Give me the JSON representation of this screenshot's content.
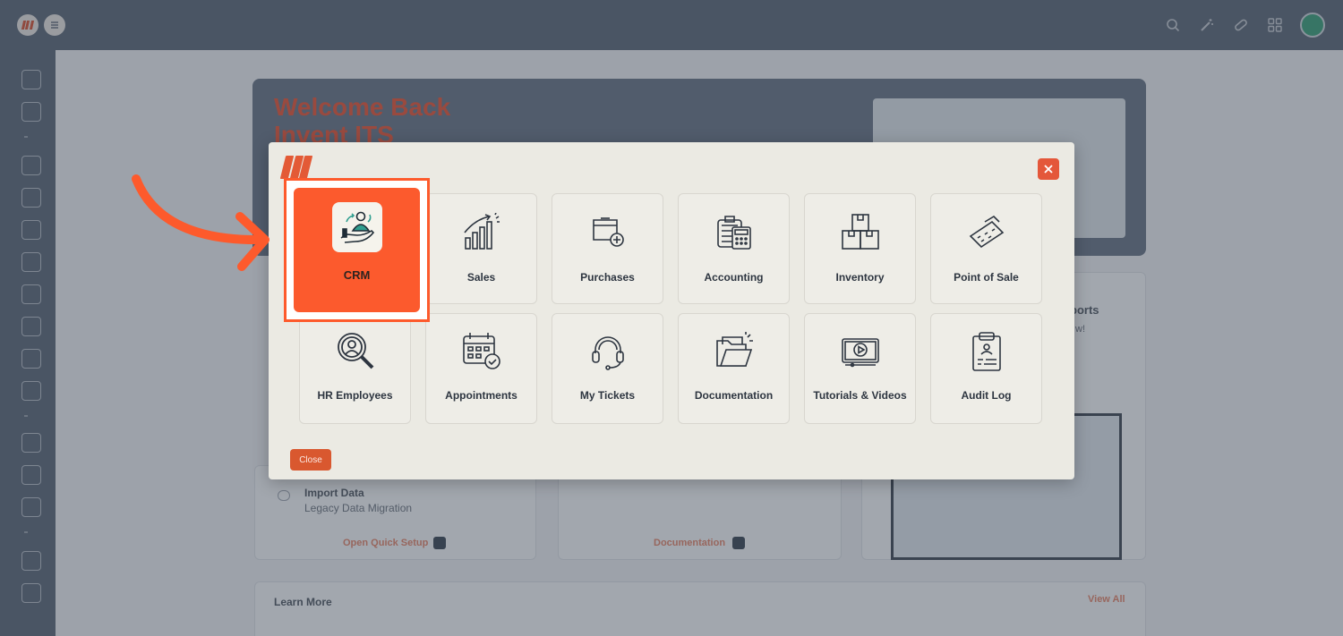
{
  "background": {
    "hero_title": "Welcome Back Invent ITS",
    "cards": {
      "import_title": "Import Data",
      "import_sub": "Legacy Data Migration",
      "open_quick_setup": "Open Quick Setup",
      "documentation": "Documentation",
      "reports_partial": "ports",
      "reports_sub_partial": "w!"
    },
    "learn_more": "Learn More",
    "view_all": "View All"
  },
  "modal": {
    "apps": [
      {
        "label": "CRM",
        "icon": "crm-icon"
      },
      {
        "label": "Sales",
        "icon": "sales-chart-icon"
      },
      {
        "label": "Purchases",
        "icon": "purchases-cart-icon"
      },
      {
        "label": "Accounting",
        "icon": "accounting-calculator-icon"
      },
      {
        "label": "Inventory",
        "icon": "inventory-boxes-icon"
      },
      {
        "label": "Point of Sale",
        "icon": "pos-terminal-icon"
      },
      {
        "label": "HR Employees",
        "icon": "hr-search-icon"
      },
      {
        "label": "Appointments",
        "icon": "calendar-icon"
      },
      {
        "label": "My Tickets",
        "icon": "headset-icon"
      },
      {
        "label": "Documentation",
        "icon": "folder-icon"
      },
      {
        "label": "Tutorials & Videos",
        "icon": "video-player-icon"
      },
      {
        "label": "Audit Log",
        "icon": "clipboard-icon"
      }
    ],
    "close_label": "Close"
  },
  "colors": {
    "accent": "#fc5a2d",
    "topbar": "#5f6b7b",
    "modal_bg": "#ebeae3"
  }
}
